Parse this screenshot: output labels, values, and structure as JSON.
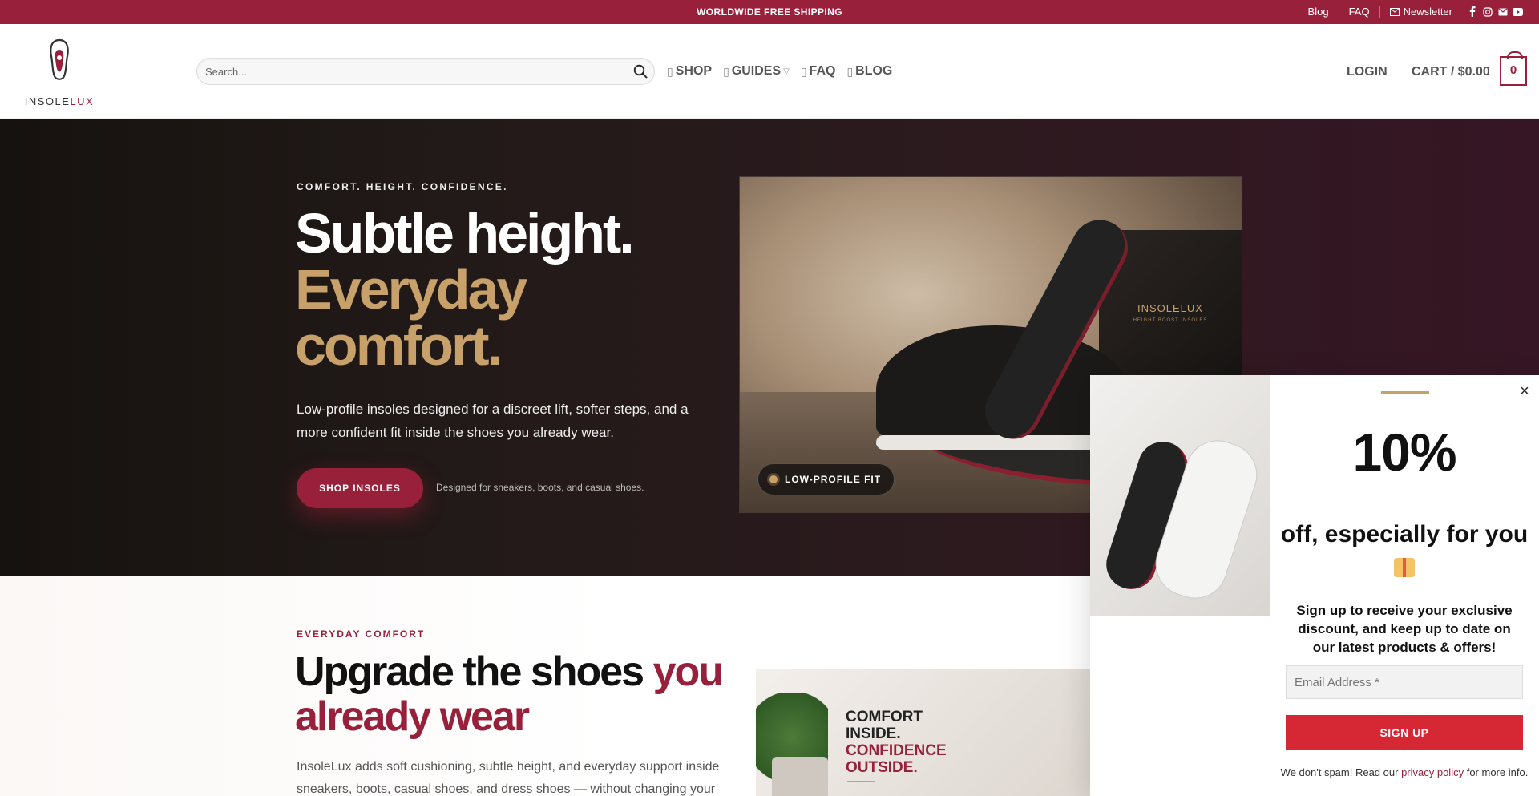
{
  "topbar": {
    "announcement": "WORLDWIDE FREE SHIPPING",
    "links": [
      "Blog",
      "FAQ",
      "Newsletter"
    ],
    "social": [
      "facebook-icon",
      "instagram-icon",
      "email-icon",
      "youtube-icon"
    ]
  },
  "header": {
    "logo": {
      "prefix": "INSOLE",
      "accent": "LUX"
    },
    "search_placeholder": "Search...",
    "nav": [
      "SHOP",
      "GUIDES",
      "FAQ",
      "BLOG"
    ],
    "login": "LOGIN",
    "cart_label": "CART / $0.00",
    "cart_count": "0"
  },
  "hero": {
    "eyebrow": "COMFORT. HEIGHT. CONFIDENCE.",
    "title_line1": "Subtle height.",
    "title_line2": "Everyday",
    "title_line3": "comfort.",
    "description": "Low-profile insoles designed for a discreet lift, softer steps, and a more confident fit inside the shoes you already wear.",
    "cta": "SHOP INSOLES",
    "note": "Designed for sneakers, boots, and casual shoes.",
    "image_box_label": "INSOLELUX",
    "image_box_sub": "HEIGHT BOOST INSOLES",
    "badge": "LOW-PROFILE FIT"
  },
  "section2": {
    "eyebrow": "EVERYDAY COMFORT",
    "title_main": "Upgrade the shoes",
    "title_accent_1": "you",
    "title_accent_2": "already wear",
    "description": "InsoleLux adds soft cushioning, subtle height, and everyday support inside sneakers, boots, casual shoes, and dress shoes — without changing your",
    "image_text_1": "COMFORT",
    "image_text_2": "INSIDE.",
    "image_text_3": "CONFIDENCE",
    "image_text_4": "OUTSIDE."
  },
  "popup": {
    "close": "×",
    "headline": "10%",
    "subheadline": "off, especially for you",
    "message": "Sign up to receive your exclusive discount, and keep up to date on our latest products & offers!",
    "email_placeholder": "Email Address *",
    "signup": "SIGN UP",
    "spam_pre": "We don't spam! Read our",
    "spam_link": "privacy policy",
    "spam_post": "for more info."
  },
  "colors": {
    "brand": "#99203a",
    "gold": "#c8a06a",
    "signup": "#d62734"
  }
}
